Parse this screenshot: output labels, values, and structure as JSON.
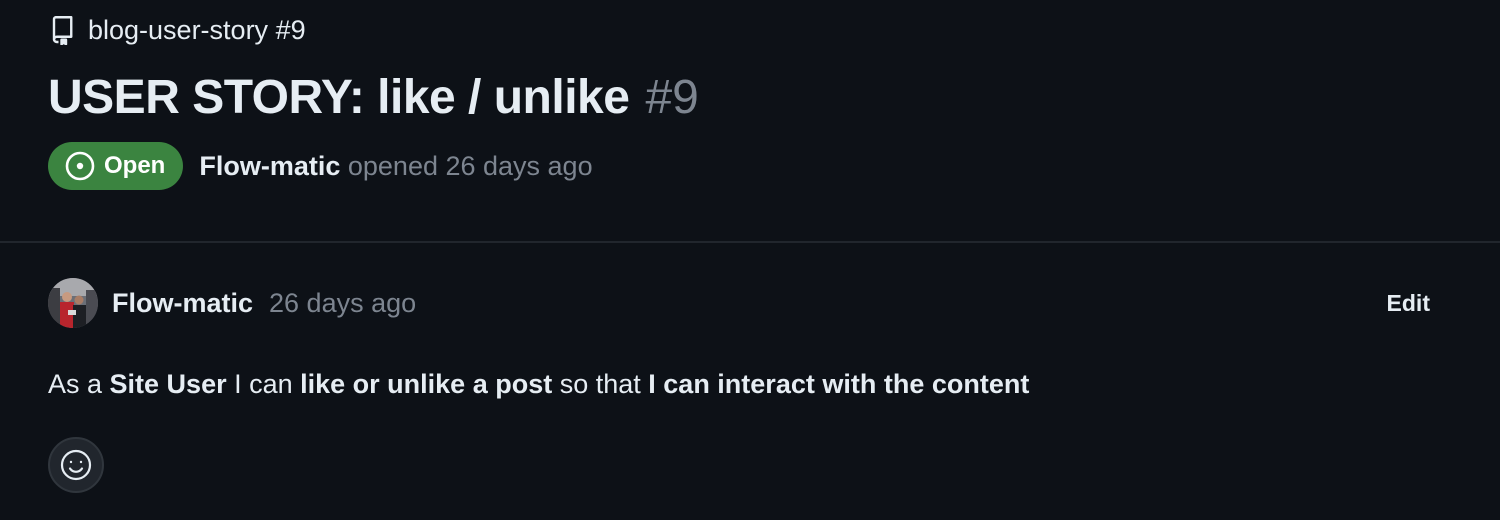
{
  "breadcrumb": {
    "icon": "repo-icon",
    "repo_label": "blog-user-story #9"
  },
  "issue": {
    "title": "USER STORY: like / unlike",
    "number": "#9",
    "state": "Open",
    "state_icon": "issue-open-icon",
    "state_color": "#3b8440",
    "author": "Flow-matic",
    "opened_text": "opened 26 days ago"
  },
  "comment": {
    "author": "Flow-matic",
    "time": "26 days ago",
    "edit_label": "Edit",
    "body": {
      "t1": "As a ",
      "b1": "Site User",
      "t2": " I can ",
      "b2": "like or unlike a post",
      "t3": " so that ",
      "b3": "I can interact with the content"
    },
    "reaction_icon": "smiley-icon"
  },
  "colors": {
    "background": "#0d1117",
    "text": "#e6edf3",
    "muted": "#7d8590",
    "divider": "#21262d"
  }
}
